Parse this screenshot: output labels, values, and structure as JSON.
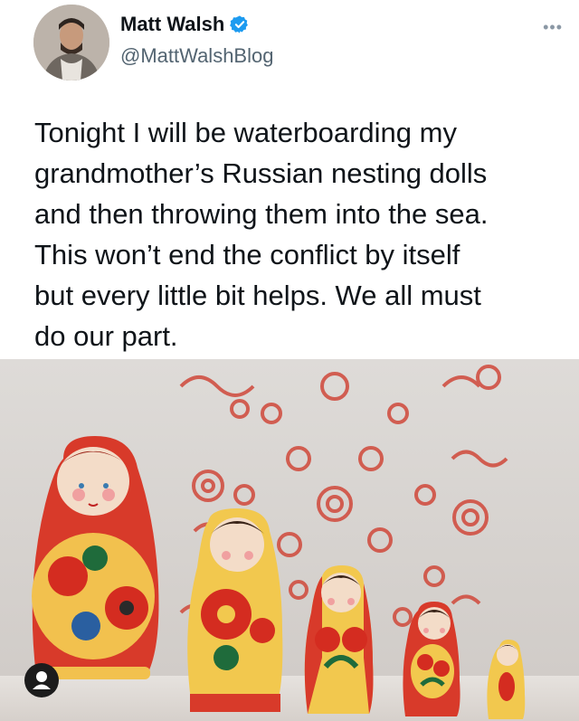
{
  "author": {
    "display_name": "Matt Walsh",
    "handle": "@MattWalshBlog",
    "verified_icon": "verified-badge-icon",
    "verified_color": "#1d9bf0"
  },
  "tweet": {
    "text": "Tonight I will be waterboarding my\ngrandmother’s Russian nesting dolls\nand then throwing them into the sea.\nThis won’t end the conflict by itself\nbut every little bit helps. We all must\ndo our part."
  },
  "more_icon": "more-options-icon",
  "media": {
    "subject": "russian-nesting-dolls-photo",
    "profile_badge_icon": "user-profile-icon"
  }
}
